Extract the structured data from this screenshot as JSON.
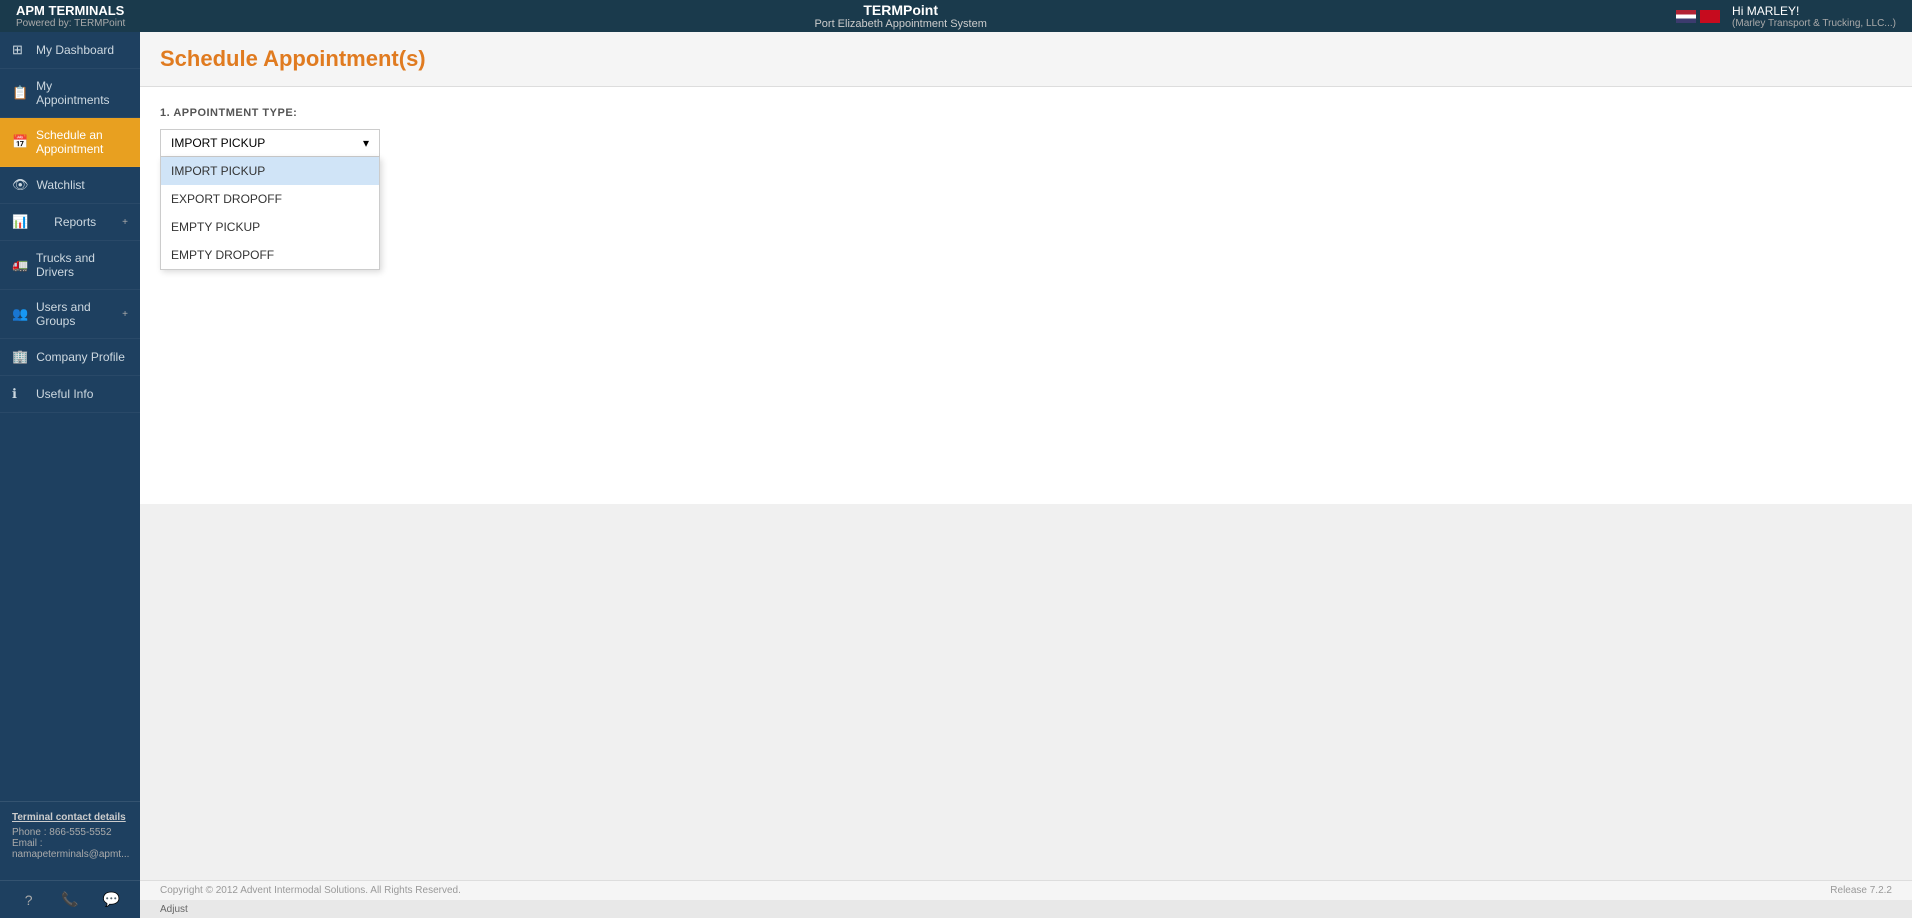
{
  "header": {
    "logo_text": "APM TERMINALS",
    "logo_tagline": "Powered by: TERMPoint",
    "system_name": "TERMPoint",
    "system_subtitle": "Port Elizabeth Appointment System",
    "user_greeting": "Hi MARLEY!",
    "user_company": "(Marley Transport & Trucking, LLC...)"
  },
  "sidebar": {
    "items": [
      {
        "id": "dashboard",
        "label": "My Dashboard",
        "icon": "⊞",
        "active": false
      },
      {
        "id": "appointments",
        "label": "My Appointments",
        "icon": "📋",
        "active": false
      },
      {
        "id": "schedule",
        "label": "Schedule an Appointment",
        "icon": "📅",
        "active": true
      },
      {
        "id": "watchlist",
        "label": "Watchlist",
        "icon": "👁",
        "active": false
      },
      {
        "id": "reports",
        "label": "Reports",
        "icon": "📊",
        "active": false,
        "expandable": true
      },
      {
        "id": "trucks",
        "label": "Trucks and Drivers",
        "icon": "🚛",
        "active": false
      },
      {
        "id": "users",
        "label": "Users and Groups",
        "icon": "👥",
        "active": false,
        "expandable": true
      },
      {
        "id": "company",
        "label": "Company Profile",
        "icon": "🏢",
        "active": false
      },
      {
        "id": "useful",
        "label": "Useful Info",
        "icon": "ℹ",
        "active": false
      }
    ],
    "footer": {
      "contact_title": "Terminal contact details",
      "phone_label": "Phone :",
      "phone_value": "866-555-5552",
      "email_label": "Email :",
      "email_value": "namapeterminals@apmt..."
    },
    "footer_actions": [
      {
        "id": "help",
        "icon": "?",
        "label": "Help"
      },
      {
        "id": "phone",
        "icon": "📞",
        "label": "Phone"
      },
      {
        "id": "chat",
        "icon": "💬",
        "label": "Chat"
      }
    ]
  },
  "main": {
    "page_title": "Schedule Appointment(s)",
    "section_label": "1. APPOINTMENT TYPE:",
    "dropdown": {
      "selected": "IMPORT PICKUP",
      "options": [
        {
          "value": "IMPORT PICKUP",
          "label": "IMPORT PICKUP",
          "selected": true
        },
        {
          "value": "EXPORT DROPOFF",
          "label": "EXPORT DROPOFF",
          "selected": false
        },
        {
          "value": "EMPTY PICKUP",
          "label": "EMPTY PICKUP",
          "selected": false
        },
        {
          "value": "EMPTY DROPOFF",
          "label": "EMPTY DROPOFF",
          "selected": false
        }
      ]
    }
  },
  "bottom": {
    "copyright": "Copyright © 2012 Advent Intermodal Solutions. All Rights Reserved.",
    "release": "Release 7.2.2",
    "adjust_label": "Adjust"
  }
}
